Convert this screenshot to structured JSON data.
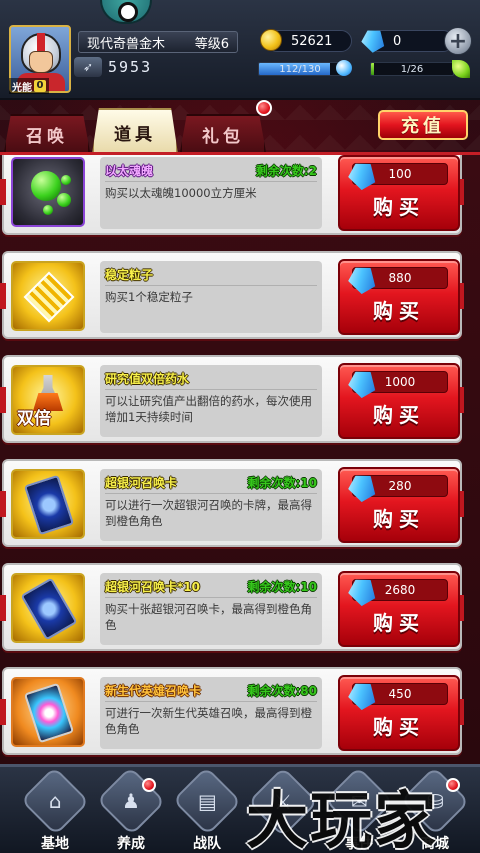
{
  "player": {
    "name": "现代奇兽金木",
    "level": "等级6",
    "energy_label": "光能",
    "energy_level": "0",
    "power": "5953"
  },
  "resources": {
    "coins": "52621",
    "gems": "0",
    "water": "112/130",
    "water_fraction": 0.86,
    "leaf": "1/26",
    "leaf_fraction": 0.04
  },
  "tabs": [
    {
      "label": "召唤",
      "active": false
    },
    {
      "label": "道具",
      "active": true
    },
    {
      "label": "礼包",
      "active": false
    }
  ],
  "recharge_label": "充值",
  "buy_label": "购买",
  "items": [
    {
      "name": "以太魂魄",
      "remaining": "剩余次数:2",
      "desc": "购买以太魂魄10000立方厘米",
      "price": "100",
      "icon": "ether-soul-icon"
    },
    {
      "name": "稳定粒子",
      "remaining": "",
      "desc": "购买1个稳定粒子",
      "price": "880",
      "icon": "stable-particle-icon"
    },
    {
      "name": "研究值双倍药水",
      "remaining": "",
      "desc": "可以让研究值产出翻倍的药水，每次使用增加1天持续时间",
      "price": "1000",
      "icon": "double-potion-icon",
      "icon_text": "双倍"
    },
    {
      "name": "超银河召唤卡",
      "remaining": "剩余次数:10",
      "desc": "可以进行一次超银河召唤的卡牌，最高得到橙色角色",
      "price": "280",
      "icon": "galaxy-card-icon"
    },
    {
      "name": "超银河召唤卡*10",
      "remaining": "剩余次数:10",
      "desc": "购买十张超银河召唤卡，最高得到橙色角色",
      "price": "2680",
      "icon": "galaxy-card-pack-icon"
    },
    {
      "name": "新生代英雄召唤卡",
      "remaining": "剩余次数:80",
      "desc": "可进行一次新生代英雄召唤，最高得到橙色角色",
      "price": "450",
      "icon": "hero-card-icon"
    }
  ],
  "nav": [
    {
      "label": "基地",
      "icon": "base-icon"
    },
    {
      "label": "养成",
      "icon": "train-icon"
    },
    {
      "label": "战队",
      "icon": "team-icon"
    },
    {
      "label": "",
      "icon": "battle-icon"
    },
    {
      "label": "事件",
      "icon": "event-icon"
    },
    {
      "label": "商城",
      "icon": "shop-icon"
    }
  ],
  "watermark": "大玩家",
  "colors": {
    "accent_red": "#e3161f",
    "gold": "#d9b244",
    "green_text": "#36c71c"
  }
}
